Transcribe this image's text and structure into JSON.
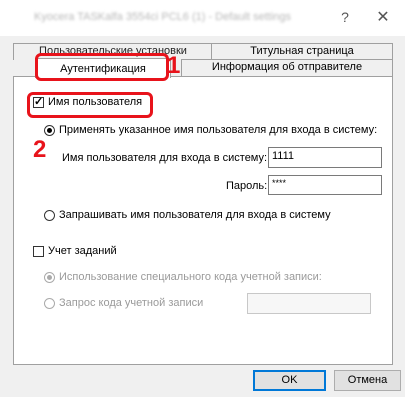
{
  "window": {
    "title": "Kyocera TASKalfa 3554ci PCL6 (1) - Default settings",
    "help_glyph": "?",
    "close_glyph": "✕"
  },
  "tabs": {
    "row1": [
      "Пользовательские установки",
      "Титульная страница"
    ],
    "row2": [
      "Аутентификация",
      "Информация об отправителе"
    ],
    "active": "Аутентификация"
  },
  "annotations": {
    "step1": "1",
    "step2": "2"
  },
  "auth": {
    "username_checkbox": {
      "label": "Имя пользователя",
      "checked": true
    },
    "use_specified_radio": {
      "label": "Применять указанное имя пользователя для входа в систему:",
      "selected": true
    },
    "login_name": {
      "label": "Имя пользователя для входа в систему:",
      "value": "1111"
    },
    "password": {
      "label": "Пароль:",
      "value": "****"
    },
    "prompt_radio": {
      "label": "Запрашивать имя пользователя для входа в систему",
      "selected": false
    }
  },
  "job_accounting": {
    "checkbox": {
      "label": "Учет заданий",
      "checked": false
    },
    "use_code_radio": {
      "label": "Использование специального кода учетной записи:",
      "selected": true,
      "disabled": true
    },
    "prompt_code_radio": {
      "label": "Запрос кода учетной записи",
      "selected": false,
      "disabled": true
    },
    "code_value": ""
  },
  "buttons": {
    "ok": "OK",
    "cancel": "Отмена"
  },
  "colors": {
    "annotation_red": "#e8131b",
    "default_button_border": "#0078d7"
  }
}
